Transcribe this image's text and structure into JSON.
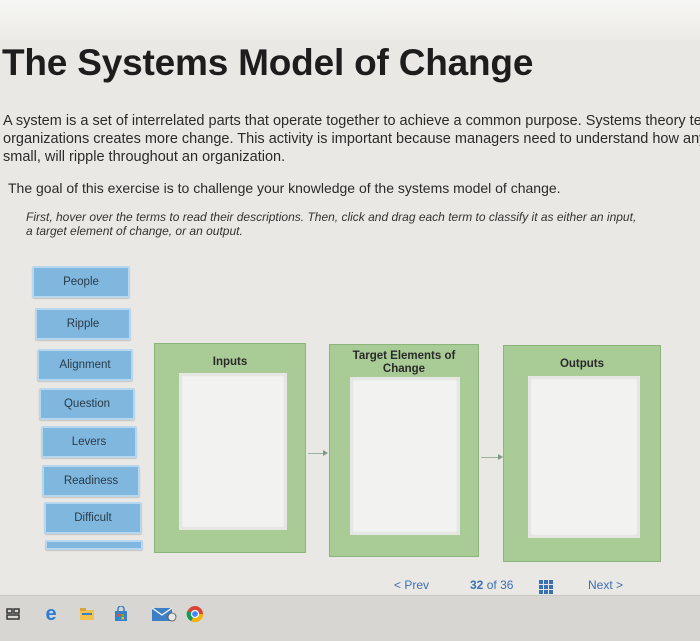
{
  "page": {
    "title": "The Systems Model of Change",
    "intro_lines": [
      "A system is a set of interrelated parts that operate together to achieve a common purpose. Systems theory teache",
      "organizations creates more change. This activity is important because managers need to understand how any cha",
      "small, will ripple throughout an organization."
    ],
    "goal": "The goal of this exercise is to challenge your knowledge of the systems model of change.",
    "instruction_lines": [
      "First, hover over the terms to read their descriptions. Then, click and drag each term to classify it as either an input,",
      "a target element of change, or an output."
    ]
  },
  "terms": [
    "People",
    "Ripple",
    "Alignment",
    "Question",
    "Levers",
    "Readiness",
    "Difficult"
  ],
  "panels": {
    "inputs": "Inputs",
    "target_line1": "Target Elements of",
    "target_line2": "Change",
    "outputs": "Outputs"
  },
  "pager": {
    "prev": "< Prev",
    "current": "32",
    "of": "of",
    "total": "36",
    "next": "Next >"
  },
  "taskbar": {
    "icons": [
      "task-view-icon",
      "edge-browser-icon",
      "file-explorer-icon",
      "store-icon",
      "mail-icon",
      "chrome-icon"
    ]
  },
  "colors": {
    "term_fill": "#7fb7df",
    "panel_fill": "#a9cc97",
    "link_color": "#3b6fb5"
  }
}
